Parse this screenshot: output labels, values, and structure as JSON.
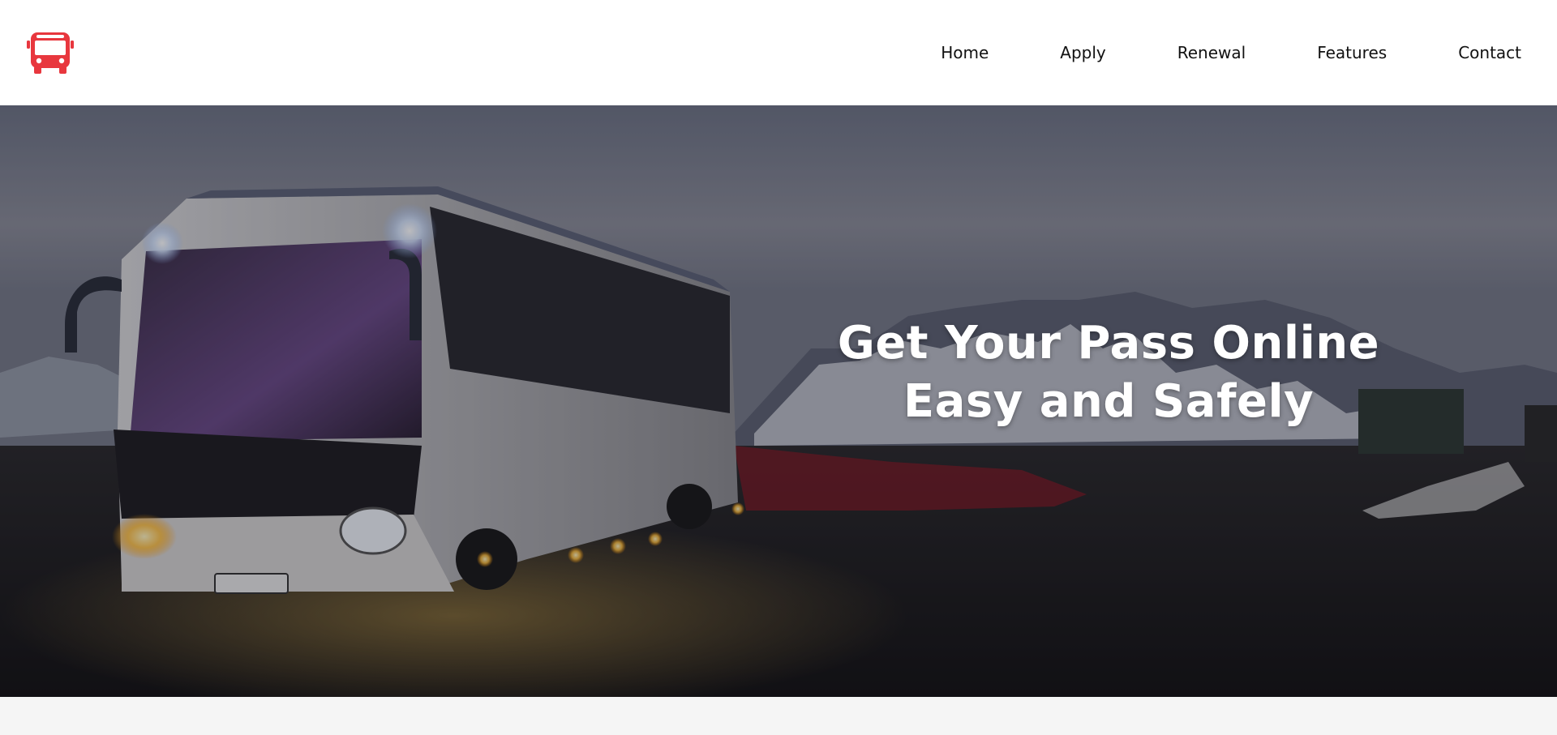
{
  "header": {
    "logo_icon": "bus-icon",
    "logo_color": "#e8373e",
    "nav": [
      {
        "label": "Home"
      },
      {
        "label": "Apply"
      },
      {
        "label": "Renewal"
      },
      {
        "label": "Features"
      },
      {
        "label": "Contact"
      }
    ]
  },
  "hero": {
    "image": "bus-at-dusk-in-snowy-mountains",
    "heading_line1": "Get Your Pass Online",
    "heading_line2": "Easy and Safely"
  }
}
